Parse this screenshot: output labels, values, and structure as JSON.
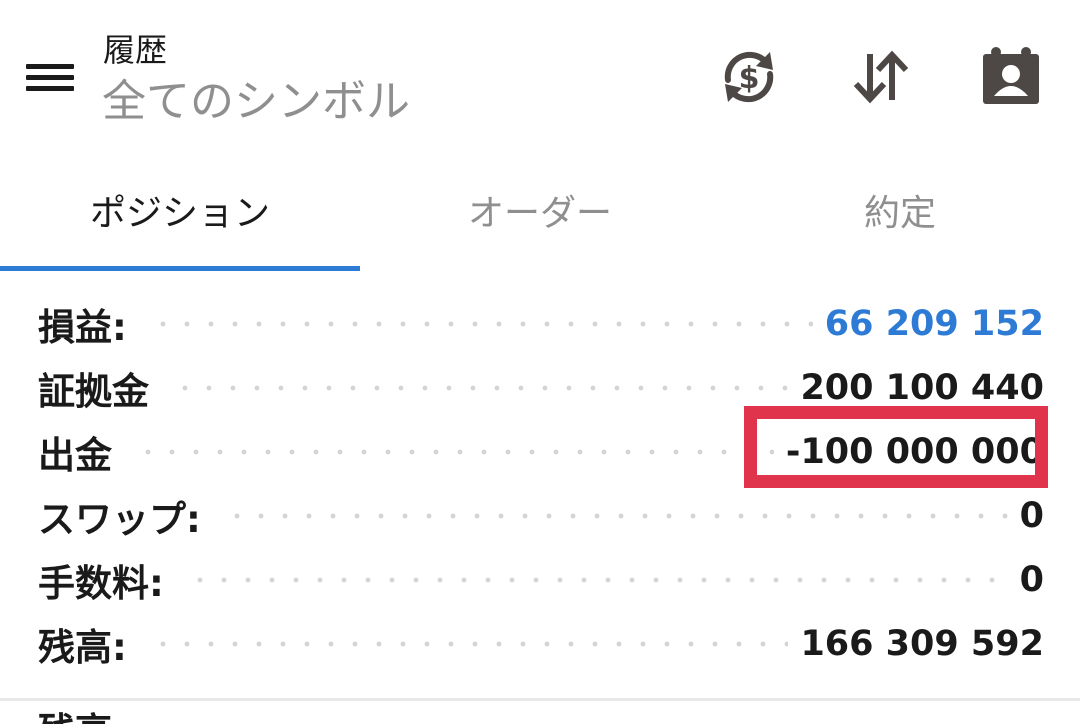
{
  "header": {
    "title_small": "履歴",
    "title_large": "全てのシンボル",
    "icons": [
      "menu-icon",
      "currency-exchange-icon",
      "sort-icon",
      "contact-card-icon"
    ]
  },
  "tabs": [
    {
      "label": "ポジション",
      "active": true
    },
    {
      "label": "オーダー",
      "active": false
    },
    {
      "label": "約定",
      "active": false
    }
  ],
  "summary": [
    {
      "label": "損益:",
      "value": "66 209 152",
      "highlight_color": "#2e7bd6"
    },
    {
      "label": "証拠金",
      "value": "200 100 440"
    },
    {
      "label": "出金",
      "value": "-100 000 000",
      "boxed": true
    },
    {
      "label": "スワップ:",
      "value": "0"
    },
    {
      "label": "手数料:",
      "value": "0"
    },
    {
      "label": "残高:",
      "value": "166 309 592"
    }
  ],
  "cutoff_text": "残高",
  "colors": {
    "accent_blue": "#2e7bd6",
    "highlight_red": "#e0344c",
    "muted_text": "#8f8f8f",
    "icon_dark": "#4d4745"
  }
}
